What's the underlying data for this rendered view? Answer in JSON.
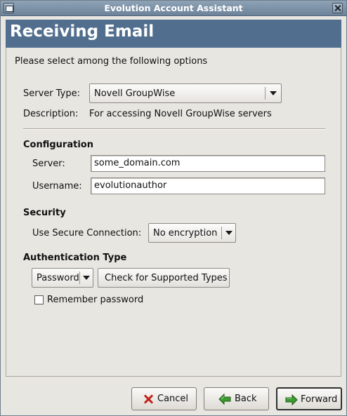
{
  "window": {
    "title": "Evolution Account Assistant"
  },
  "banner": {
    "title": "Receiving Email"
  },
  "intro": "Please select among the following options",
  "server_type": {
    "label": "Server Type:",
    "value": "Novell GroupWise"
  },
  "description": {
    "label": "Description:",
    "value": "For accessing Novell GroupWise servers"
  },
  "configuration": {
    "heading": "Configuration",
    "server_label": "Server:",
    "server_value": "some_domain.com",
    "username_label": "Username:",
    "username_value": "evolutionauthor"
  },
  "security": {
    "heading": "Security",
    "secure_label": "Use Secure Connection:",
    "secure_value": "No encryption"
  },
  "authentication": {
    "heading": "Authentication Type",
    "type_value": "Password",
    "check_label": "Check for Supported Types",
    "remember_label": "Remember password",
    "remember_checked": false
  },
  "buttons": {
    "cancel": "Cancel",
    "back": "Back",
    "forward": "Forward"
  },
  "icons": {
    "window_menu": "window-menu-icon",
    "close": "close-icon",
    "cancel": "cancel-x-icon",
    "back": "back-arrow-icon",
    "forward": "forward-arrow-icon"
  },
  "colors": {
    "banner": "#516e8e",
    "titlebar": "#7a8fa4",
    "arrow_green": "#3c9a2f",
    "cancel_red": "#c0231c"
  }
}
